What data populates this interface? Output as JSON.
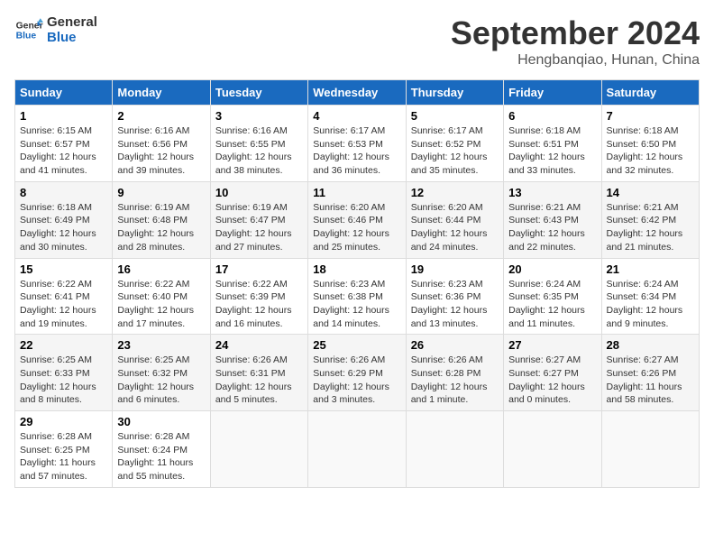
{
  "header": {
    "logo_line1": "General",
    "logo_line2": "Blue",
    "month_title": "September 2024",
    "location": "Hengbanqiao, Hunan, China"
  },
  "days_of_week": [
    "Sunday",
    "Monday",
    "Tuesday",
    "Wednesday",
    "Thursday",
    "Friday",
    "Saturday"
  ],
  "weeks": [
    [
      {
        "day": "1",
        "rise": "6:15 AM",
        "set": "6:57 PM",
        "daylight": "12 hours and 41 minutes."
      },
      {
        "day": "2",
        "rise": "6:16 AM",
        "set": "6:56 PM",
        "daylight": "12 hours and 39 minutes."
      },
      {
        "day": "3",
        "rise": "6:16 AM",
        "set": "6:55 PM",
        "daylight": "12 hours and 38 minutes."
      },
      {
        "day": "4",
        "rise": "6:17 AM",
        "set": "6:53 PM",
        "daylight": "12 hours and 36 minutes."
      },
      {
        "day": "5",
        "rise": "6:17 AM",
        "set": "6:52 PM",
        "daylight": "12 hours and 35 minutes."
      },
      {
        "day": "6",
        "rise": "6:18 AM",
        "set": "6:51 PM",
        "daylight": "12 hours and 33 minutes."
      },
      {
        "day": "7",
        "rise": "6:18 AM",
        "set": "6:50 PM",
        "daylight": "12 hours and 32 minutes."
      }
    ],
    [
      {
        "day": "8",
        "rise": "6:18 AM",
        "set": "6:49 PM",
        "daylight": "12 hours and 30 minutes."
      },
      {
        "day": "9",
        "rise": "6:19 AM",
        "set": "6:48 PM",
        "daylight": "12 hours and 28 minutes."
      },
      {
        "day": "10",
        "rise": "6:19 AM",
        "set": "6:47 PM",
        "daylight": "12 hours and 27 minutes."
      },
      {
        "day": "11",
        "rise": "6:20 AM",
        "set": "6:46 PM",
        "daylight": "12 hours and 25 minutes."
      },
      {
        "day": "12",
        "rise": "6:20 AM",
        "set": "6:44 PM",
        "daylight": "12 hours and 24 minutes."
      },
      {
        "day": "13",
        "rise": "6:21 AM",
        "set": "6:43 PM",
        "daylight": "12 hours and 22 minutes."
      },
      {
        "day": "14",
        "rise": "6:21 AM",
        "set": "6:42 PM",
        "daylight": "12 hours and 21 minutes."
      }
    ],
    [
      {
        "day": "15",
        "rise": "6:22 AM",
        "set": "6:41 PM",
        "daylight": "12 hours and 19 minutes."
      },
      {
        "day": "16",
        "rise": "6:22 AM",
        "set": "6:40 PM",
        "daylight": "12 hours and 17 minutes."
      },
      {
        "day": "17",
        "rise": "6:22 AM",
        "set": "6:39 PM",
        "daylight": "12 hours and 16 minutes."
      },
      {
        "day": "18",
        "rise": "6:23 AM",
        "set": "6:38 PM",
        "daylight": "12 hours and 14 minutes."
      },
      {
        "day": "19",
        "rise": "6:23 AM",
        "set": "6:36 PM",
        "daylight": "12 hours and 13 minutes."
      },
      {
        "day": "20",
        "rise": "6:24 AM",
        "set": "6:35 PM",
        "daylight": "12 hours and 11 minutes."
      },
      {
        "day": "21",
        "rise": "6:24 AM",
        "set": "6:34 PM",
        "daylight": "12 hours and 9 minutes."
      }
    ],
    [
      {
        "day": "22",
        "rise": "6:25 AM",
        "set": "6:33 PM",
        "daylight": "12 hours and 8 minutes."
      },
      {
        "day": "23",
        "rise": "6:25 AM",
        "set": "6:32 PM",
        "daylight": "12 hours and 6 minutes."
      },
      {
        "day": "24",
        "rise": "6:26 AM",
        "set": "6:31 PM",
        "daylight": "12 hours and 5 minutes."
      },
      {
        "day": "25",
        "rise": "6:26 AM",
        "set": "6:29 PM",
        "daylight": "12 hours and 3 minutes."
      },
      {
        "day": "26",
        "rise": "6:26 AM",
        "set": "6:28 PM",
        "daylight": "12 hours and 1 minute."
      },
      {
        "day": "27",
        "rise": "6:27 AM",
        "set": "6:27 PM",
        "daylight": "12 hours and 0 minutes."
      },
      {
        "day": "28",
        "rise": "6:27 AM",
        "set": "6:26 PM",
        "daylight": "11 hours and 58 minutes."
      }
    ],
    [
      {
        "day": "29",
        "rise": "6:28 AM",
        "set": "6:25 PM",
        "daylight": "11 hours and 57 minutes."
      },
      {
        "day": "30",
        "rise": "6:28 AM",
        "set": "6:24 PM",
        "daylight": "11 hours and 55 minutes."
      },
      null,
      null,
      null,
      null,
      null
    ]
  ],
  "labels": {
    "sunrise": "Sunrise:",
    "sunset": "Sunset:",
    "daylight": "Daylight:"
  }
}
